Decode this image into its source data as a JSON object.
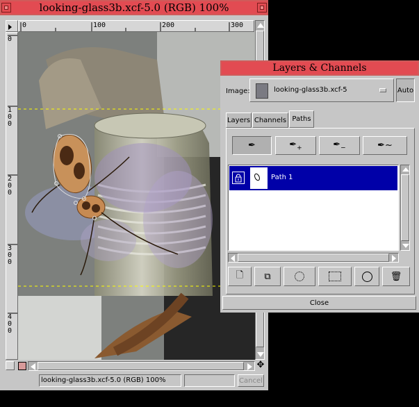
{
  "image_window": {
    "title": "looking-glass3b.xcf-5.0 (RGB) 100%",
    "ruler_top_labels": [
      "0",
      "100",
      "200",
      "300"
    ],
    "ruler_left_labels": [
      "0",
      "100",
      "200",
      "300",
      "400"
    ],
    "status_text": "looking-glass3b.xcf-5.0 (RGB) 100%",
    "cancel_label": "Cancel"
  },
  "layers_dialog": {
    "title": "Layers & Channels",
    "image_label": "Image:",
    "image_menu_value": "looking-glass3b.xcf-5",
    "auto_label": "Auto",
    "tabs": [
      {
        "label": "Layers"
      },
      {
        "label": "Channels"
      },
      {
        "label": "Paths"
      }
    ],
    "paths": [
      {
        "name": "Path 1",
        "selected": true
      }
    ],
    "close_label": "Close"
  },
  "colors": {
    "title_bar": "#e24b52",
    "selection": "#0000a8",
    "window_bg": "#c6c6c6"
  }
}
